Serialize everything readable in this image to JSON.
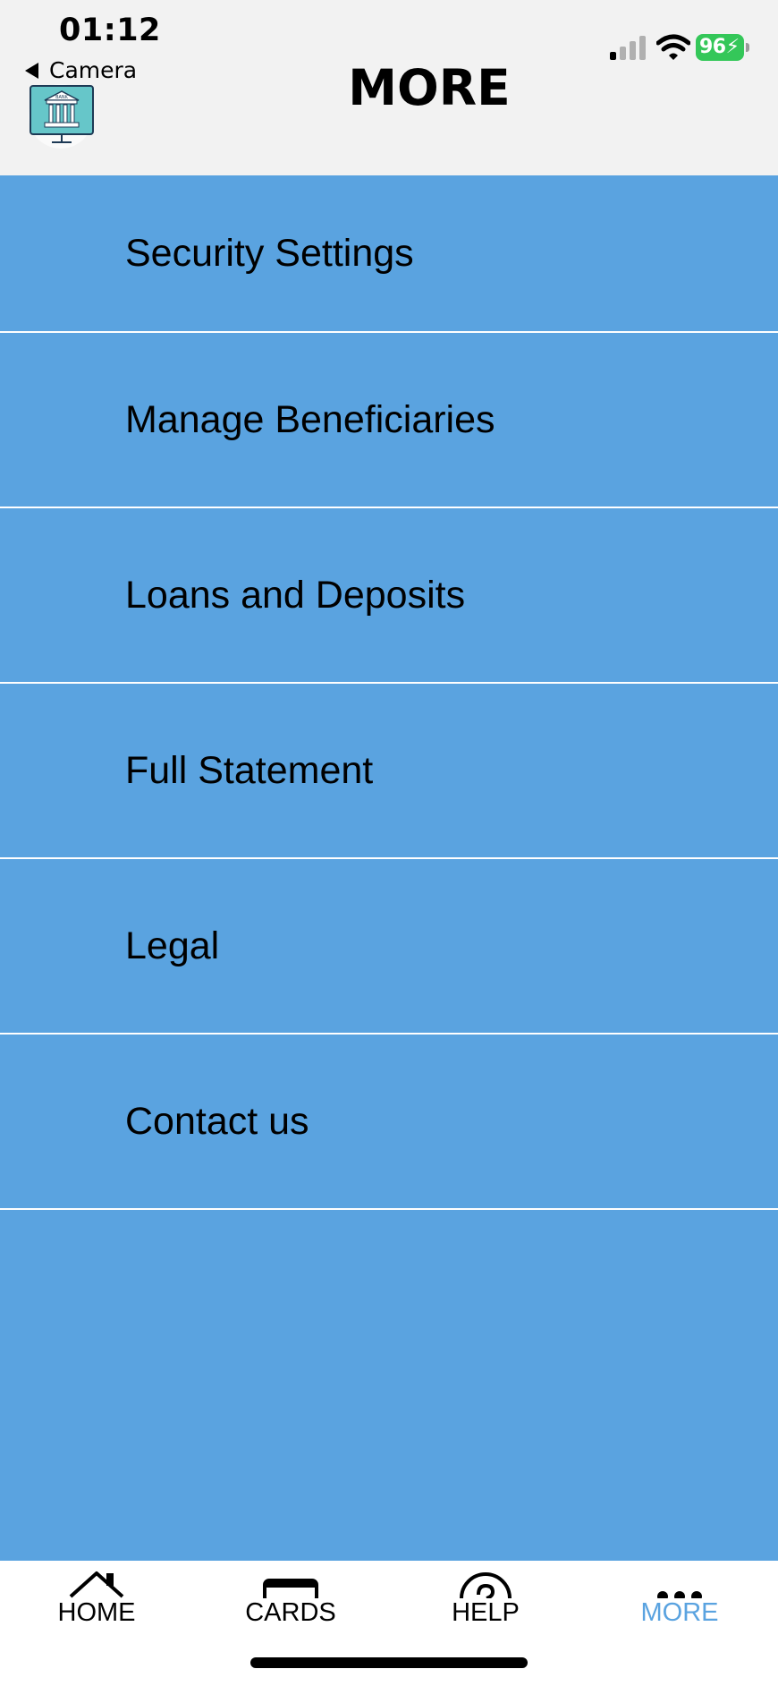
{
  "status_bar": {
    "time": "01:12",
    "back_label": "Camera",
    "battery": "96"
  },
  "header": {
    "title": "MORE",
    "logo_text": "BANK"
  },
  "menu": {
    "items": [
      {
        "label": "Security Settings"
      },
      {
        "label": "Manage Beneficiaries"
      },
      {
        "label": "Loans and Deposits"
      },
      {
        "label": "Full Statement"
      },
      {
        "label": "Legal"
      },
      {
        "label": "Contact us"
      }
    ]
  },
  "tabbar": {
    "tabs": [
      {
        "label": "HOME",
        "icon": "home-icon"
      },
      {
        "label": "CARDS",
        "icon": "card-icon"
      },
      {
        "label": "HELP",
        "icon": "help-icon"
      },
      {
        "label": "MORE",
        "icon": "more-icon",
        "active": true
      }
    ]
  },
  "colors": {
    "background": "#5aa3e0",
    "header": "#f2f2f2",
    "active_tab": "#5aa3e0",
    "battery": "#34c759"
  }
}
